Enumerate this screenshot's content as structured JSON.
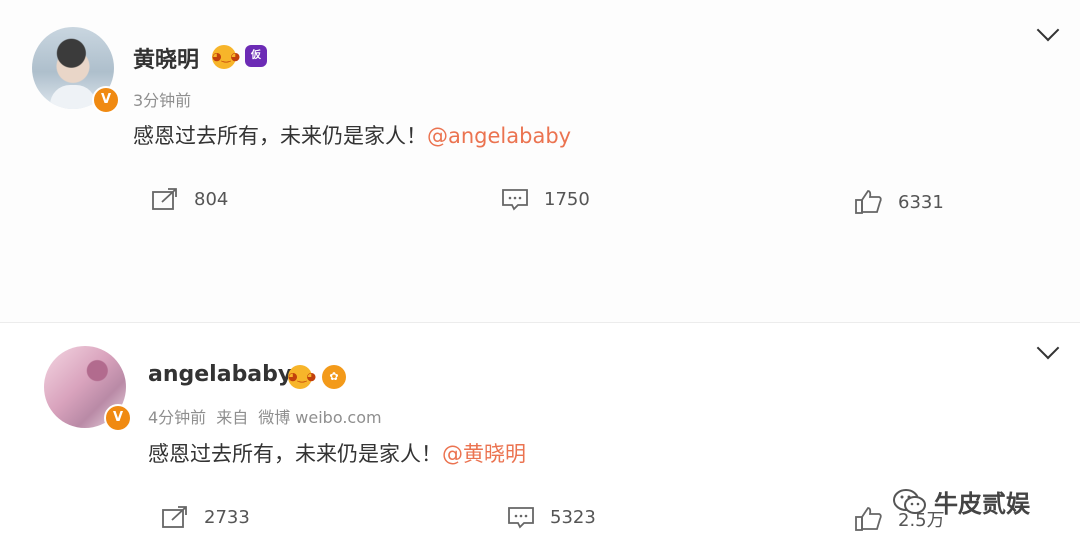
{
  "posts": [
    {
      "author": "黄晓明",
      "verified_mark": "V",
      "badge2_text": "仮",
      "time": "3分钟前",
      "source_label": "",
      "source": "",
      "text": "感恩过去所有，未来仍是家人！",
      "mention": "@angelababy",
      "actions": {
        "reposts": "804",
        "comments": "1750",
        "likes": "6331"
      }
    },
    {
      "author": "angelababy",
      "verified_mark": "V",
      "badge2_text": "",
      "time": "4分钟前",
      "source_label": "来自",
      "source": "微博 weibo.com",
      "text": "感恩过去所有，未来仍是家人！",
      "mention": "@黄晓明",
      "actions": {
        "reposts": "2733",
        "comments": "5323",
        "likes": "2.5万"
      }
    }
  ],
  "icons": {
    "more": "chevron-down-icon",
    "repost": "share-icon",
    "comment": "comment-icon",
    "like": "thumbs-up-icon"
  },
  "watermark": {
    "text": "牛皮贰娱",
    "icon": "wechat-icon"
  },
  "colors": {
    "mention": "#eb7350",
    "verified": "#f08a12",
    "meta": "#8f8f8f"
  }
}
